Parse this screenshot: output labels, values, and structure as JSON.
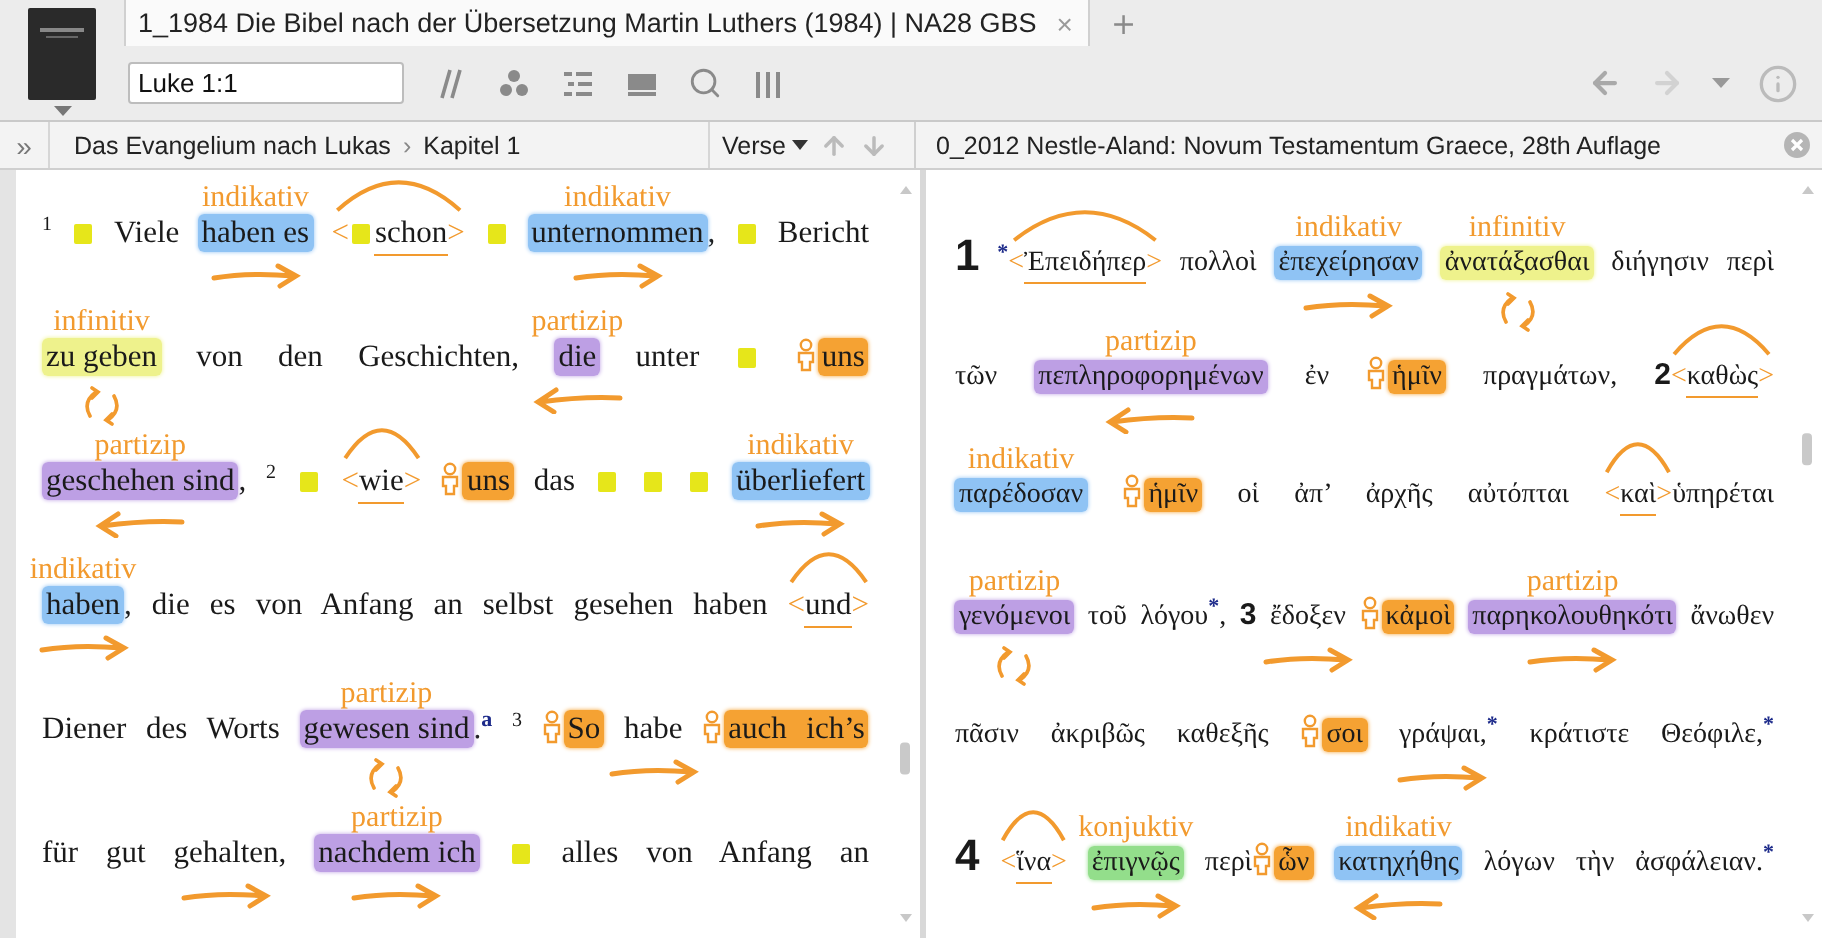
{
  "tabs": [
    {
      "title": "1_1984 Die Bibel nach der Übersetzung Martin Luthers (1984) | NA28 GBS",
      "close": "×",
      "selected": true
    }
  ],
  "new_tab": "+",
  "reference": {
    "value": "Luke 1:1"
  },
  "nav": [
    {
      "kind": "back",
      "disabled": false
    },
    {
      "kind": "forward",
      "disabled": true
    }
  ],
  "left_pane": {
    "toggle": "»",
    "breadcrumb": [
      "Das Evangelium nach Lukas",
      "Kapitel 1"
    ],
    "separator": "›",
    "verse_menu": "Verse",
    "lines": [
      {
        "tokens": [
          {
            "kind": "verse_sup",
            "text": "1"
          },
          {
            "kind": "note"
          },
          {
            "kind": "plain",
            "text": "Viele"
          },
          {
            "kind": "indicative",
            "text": "haben es",
            "label": "indikativ",
            "arrow": {
              "kind": "right"
            }
          },
          {
            "kind": "conjunction",
            "open": "<",
            "text": "schon",
            "close": ">",
            "note": true
          },
          {
            "kind": "note"
          },
          {
            "kind": "indicative",
            "text": "unternommen",
            "label": "indikativ",
            "arrow": {
              "kind": "right"
            }
          },
          {
            "kind": "plain",
            "text": ",",
            "join": true
          },
          {
            "kind": "note"
          },
          {
            "kind": "plain",
            "text": "Bericht"
          }
        ]
      },
      {
        "tokens": [
          {
            "kind": "infinitive",
            "text": "zu geben",
            "label": "infinitiv",
            "arrow": {
              "kind": "cycle"
            }
          },
          {
            "kind": "plain",
            "text": "von den Geschichten,"
          },
          {
            "kind": "participle",
            "text": "die",
            "label": "partizip",
            "arrow": {
              "kind": "left"
            }
          },
          {
            "kind": "plain",
            "text": "unter"
          },
          {
            "kind": "note"
          },
          {
            "kind": "pronoun",
            "text": "uns",
            "person": true
          }
        ]
      },
      {
        "tokens": [
          {
            "kind": "participle",
            "text": "geschehen sind",
            "label": "partizip",
            "arrow": {
              "kind": "left"
            }
          },
          {
            "kind": "plain",
            "text": ",",
            "join": true
          },
          {
            "kind": "verse_sup",
            "text": "2"
          },
          {
            "kind": "note"
          },
          {
            "kind": "conjunction",
            "open": "<",
            "text": "wie",
            "close": ">"
          },
          {
            "kind": "pronoun",
            "text": "uns",
            "person": true
          },
          {
            "kind": "plain",
            "text": "das"
          },
          {
            "kind": "note"
          },
          {
            "kind": "note"
          },
          {
            "kind": "note"
          },
          {
            "kind": "indicative",
            "text": "überliefert",
            "label": "indikativ",
            "arrow": {
              "kind": "right"
            }
          }
        ]
      },
      {
        "tokens": [
          {
            "kind": "indicative",
            "text": "haben",
            "label": "indikativ",
            "arrow": {
              "kind": "right"
            }
          },
          {
            "kind": "plain",
            "text": ", die es von Anfang an selbst gesehen haben",
            "join": true
          },
          {
            "kind": "conjunction",
            "open": "<",
            "text": "und",
            "close": ">"
          }
        ]
      },
      {
        "tokens": [
          {
            "kind": "plain",
            "text": "Diener des Worts"
          },
          {
            "kind": "participle",
            "text": "gewesen sind",
            "label": "partizip",
            "arrow": {
              "kind": "cycle"
            }
          },
          {
            "kind": "plain",
            "text": ".",
            "join": true
          },
          {
            "kind": "footnote",
            "text": "a",
            "join": true
          },
          {
            "kind": "verse_sup",
            "text": "3"
          },
          {
            "kind": "pronoun",
            "text": "So",
            "person": true
          },
          {
            "kind": "plain",
            "text": "habe",
            "arrow": {
              "kind": "right"
            }
          },
          {
            "kind": "pronoun",
            "text": "auch ich’s",
            "person": true
          }
        ]
      },
      {
        "tokens": [
          {
            "kind": "plain",
            "text": "für gut"
          },
          {
            "kind": "plain",
            "text": "gehalten",
            "arrow": {
              "kind": "right"
            }
          },
          {
            "kind": "plain",
            "text": ",",
            "join": true
          },
          {
            "kind": "participle",
            "text": "nachdem ich",
            "label": "partizip",
            "arrow": {
              "kind": "right"
            }
          },
          {
            "kind": "note"
          },
          {
            "kind": "plain",
            "text": "alles von Anfang an"
          }
        ]
      }
    ]
  },
  "right_pane": {
    "title": "0_2012 Nestle-Aland: Novum Testamentum Graece, 28th Auflage",
    "lines": [
      {
        "tokens": [
          {
            "kind": "verse",
            "text": "1"
          },
          {
            "kind": "footnote",
            "text": "*"
          },
          {
            "kind": "conjunction",
            "open": "<",
            "text": "Ἐπειδήπερ",
            "close": ">",
            "join": true
          },
          {
            "kind": "plain",
            "text": "πολλοὶ"
          },
          {
            "kind": "indicative",
            "text": "ἐπεχείρησαν",
            "label": "indikativ",
            "arrow": {
              "kind": "right"
            }
          },
          {
            "kind": "infinitive",
            "text": "ἀνατάξασθαι",
            "label": "infinitiv",
            "arrow": {
              "kind": "cycle"
            }
          },
          {
            "kind": "plain",
            "text": "διήγησιν περὶ"
          }
        ]
      },
      {
        "tokens": [
          {
            "kind": "plain",
            "text": "τῶν"
          },
          {
            "kind": "participle",
            "text": "πεπληροφορημένων",
            "label": "partizip",
            "arrow": {
              "kind": "left"
            }
          },
          {
            "kind": "plain",
            "text": "ἐν"
          },
          {
            "kind": "pronoun",
            "text": "ἡμῖν",
            "person": true
          },
          {
            "kind": "plain",
            "text": "πραγμάτων,"
          },
          {
            "kind": "verse",
            "text": "2"
          },
          {
            "kind": "conjunction",
            "open": "<",
            "text": "καθὼς",
            "close": ">",
            "join": true
          }
        ]
      },
      {
        "tokens": [
          {
            "kind": "indicative",
            "text": "παρέδοσαν",
            "label": "indikativ"
          },
          {
            "kind": "pronoun",
            "text": "ἡμῖν",
            "person": true
          },
          {
            "kind": "plain",
            "text": "οἱ ἀπ’ ἀρχῆς αὐτόπται"
          },
          {
            "kind": "conjunction",
            "open": "<",
            "text": "καὶ",
            "close": ">"
          },
          {
            "kind": "plain",
            "text": "ὑπηρέται",
            "join": true
          }
        ]
      },
      {
        "tokens": [
          {
            "kind": "participle",
            "text": "γενόμενοι",
            "label": "partizip",
            "arrow": {
              "kind": "cycle"
            }
          },
          {
            "kind": "plain",
            "text": "τοῦ λόγου"
          },
          {
            "kind": "footnote",
            "text": "*",
            "join": true
          },
          {
            "kind": "plain",
            "text": ",",
            "join": true
          },
          {
            "kind": "verse",
            "text": "3"
          },
          {
            "kind": "plain",
            "text": "ἔδοξεν",
            "arrow": {
              "kind": "right"
            }
          },
          {
            "kind": "pronoun",
            "text": "κἀμοὶ",
            "person": true
          },
          {
            "kind": "participle",
            "text": "παρηκολουθηκότι",
            "label": "partizip",
            "arrow": {
              "kind": "right"
            }
          },
          {
            "kind": "plain",
            "text": "ἄνωθεν"
          }
        ]
      },
      {
        "tokens": [
          {
            "kind": "plain",
            "text": "πᾶσιν ἀκριβῶς καθεξῆς"
          },
          {
            "kind": "pronoun",
            "text": "σοι",
            "person": true
          },
          {
            "kind": "plain",
            "text": "γράψαι,",
            "arrow": {
              "kind": "right"
            }
          },
          {
            "kind": "footnote",
            "text": "*",
            "join": true
          },
          {
            "kind": "plain",
            "text": "κράτιστε Θεόφιλε,"
          },
          {
            "kind": "footnote",
            "text": "*",
            "join": true
          }
        ]
      },
      {
        "tokens": [
          {
            "kind": "verse",
            "text": "4"
          },
          {
            "kind": "conjunction",
            "open": "<",
            "text": "ἵνα",
            "close": ">"
          },
          {
            "kind": "subjunctive",
            "text": "ἐπιγνῷς",
            "label": "konjuktiv",
            "arrow": {
              "kind": "right"
            }
          },
          {
            "kind": "plain",
            "text": "περὶ"
          },
          {
            "kind": "pronoun",
            "text": "ὧν",
            "person": true,
            "join": true
          },
          {
            "kind": "indicative",
            "text": "κατηχήθης",
            "label": "indikativ",
            "arrow": {
              "kind": "left"
            }
          },
          {
            "kind": "plain",
            "text": "λόγων τὴν ἀσφάλειαν."
          },
          {
            "kind": "footnote",
            "text": "*",
            "join": true
          }
        ]
      }
    ]
  }
}
